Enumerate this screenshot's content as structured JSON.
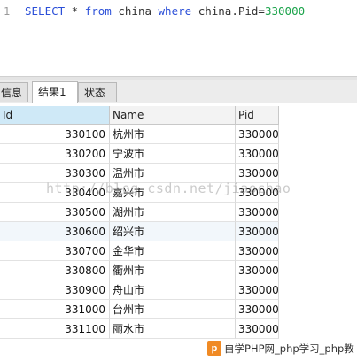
{
  "editor": {
    "line_number": "1",
    "sql": {
      "kw_select": "SELECT",
      "star": " * ",
      "kw_from": "from",
      "table": " china ",
      "kw_where": "where",
      "condition": " china.Pid=",
      "value": "330000"
    }
  },
  "tabs": [
    {
      "label": "信息"
    },
    {
      "label": "结果1"
    },
    {
      "label": "状态"
    }
  ],
  "grid": {
    "columns": [
      "Id",
      "Name",
      "Pid"
    ],
    "rows": [
      {
        "id": "330100",
        "name": "杭州市",
        "pid": "330000"
      },
      {
        "id": "330200",
        "name": "宁波市",
        "pid": "330000"
      },
      {
        "id": "330300",
        "name": "温州市",
        "pid": "330000"
      },
      {
        "id": "330400",
        "name": "嘉兴市",
        "pid": "330000"
      },
      {
        "id": "330500",
        "name": "湖州市",
        "pid": "330000"
      },
      {
        "id": "330600",
        "name": "绍兴市",
        "pid": "330000"
      },
      {
        "id": "330700",
        "name": "金华市",
        "pid": "330000"
      },
      {
        "id": "330800",
        "name": "衢州市",
        "pid": "330000"
      },
      {
        "id": "330900",
        "name": "舟山市",
        "pid": "330000"
      },
      {
        "id": "331000",
        "name": "台州市",
        "pid": "330000"
      },
      {
        "id": "331100",
        "name": "丽水市",
        "pid": "330000"
      }
    ]
  },
  "watermark": "http://blog.csdn.net/jiaochao",
  "footer_badge": {
    "icon_letter": "p",
    "text": "自学PHP网_php学习_php教"
  }
}
